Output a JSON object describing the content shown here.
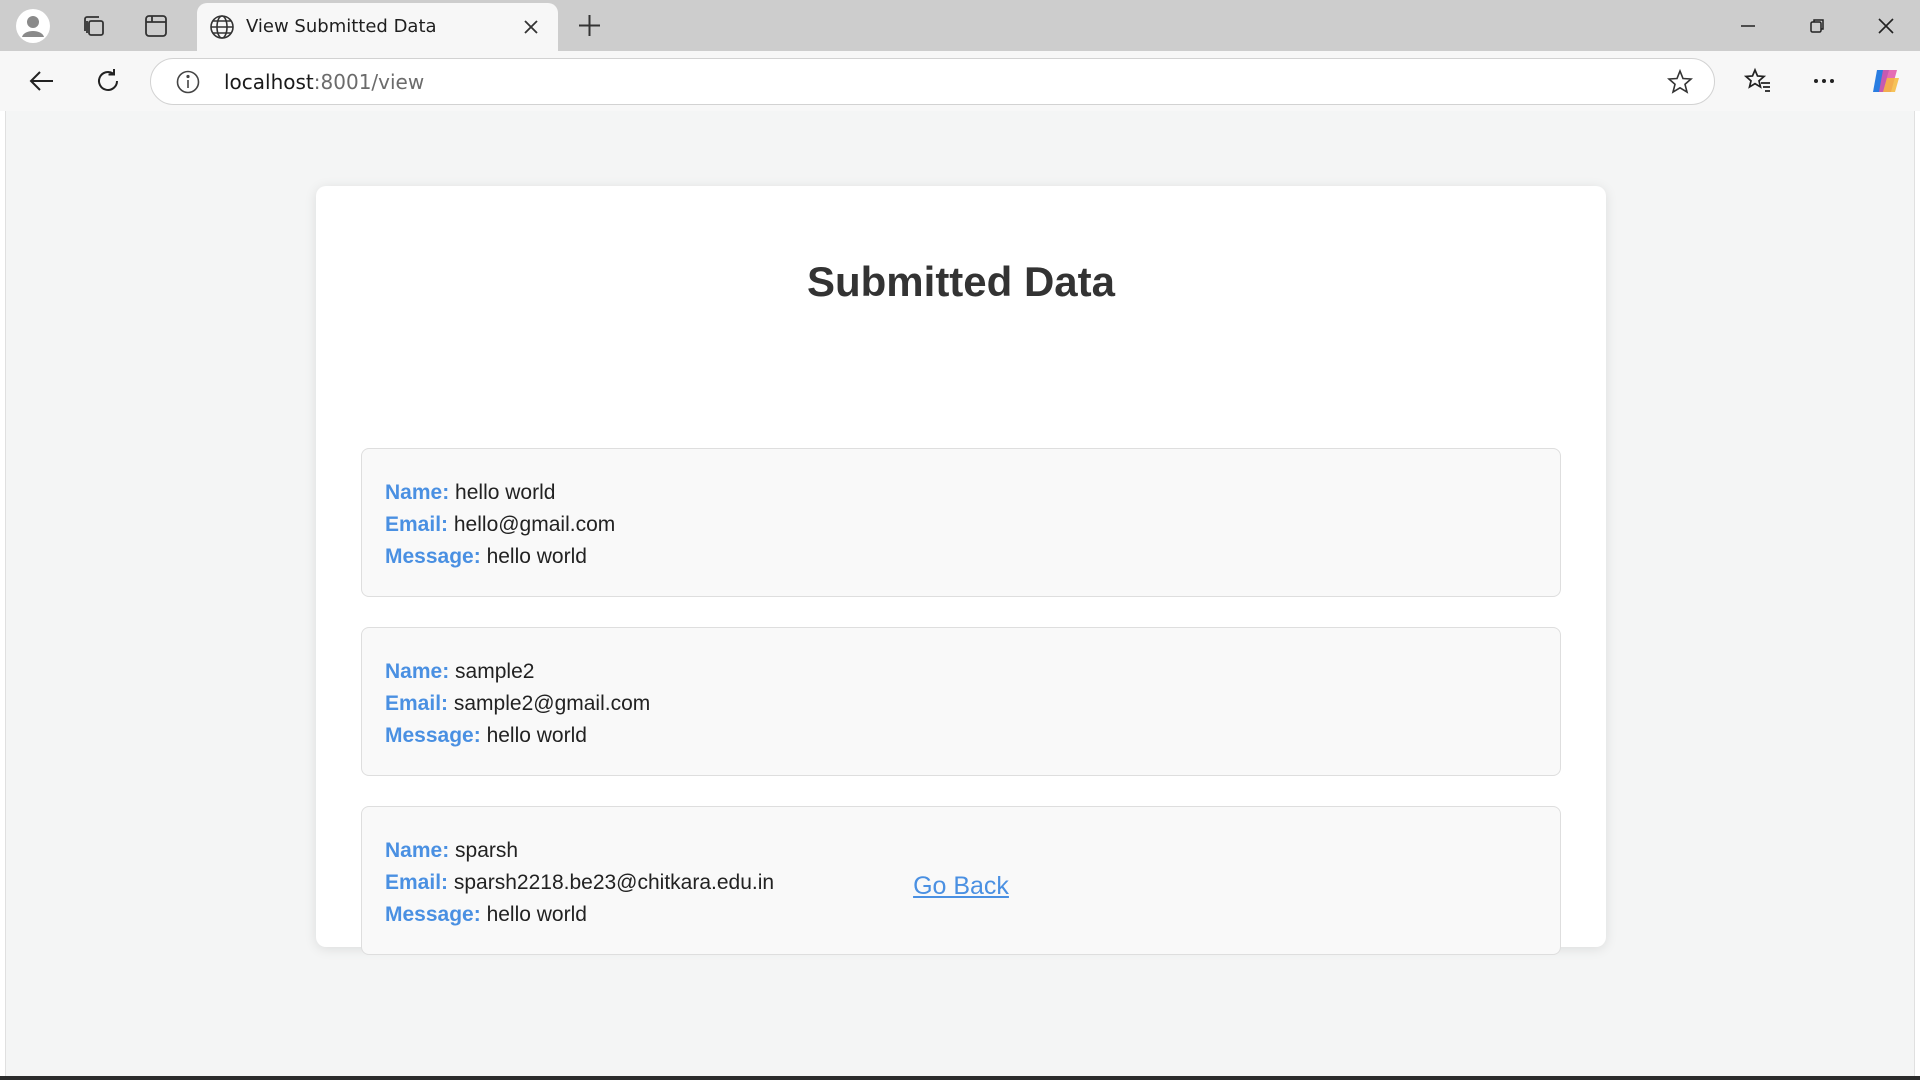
{
  "browser": {
    "tab": {
      "title": "View Submitted Data"
    },
    "address": {
      "host": "localhost",
      "path": ":8001/view"
    },
    "icons": {
      "profile": "profile-icon",
      "workspaces": "collections-icon",
      "tab_actions": "tab-actions-icon",
      "tab_globe": "globe-icon",
      "tab_close": "close-icon",
      "new_tab": "plus-icon",
      "minimize": "minimize-icon",
      "restore": "restore-icon",
      "close_window": "close-icon",
      "back": "back-arrow-icon",
      "reload": "reload-icon",
      "site_info": "info-icon",
      "favorite": "star-icon",
      "favorites": "favorites-icon",
      "more": "more-icon",
      "copilot": "copilot-icon"
    }
  },
  "page": {
    "title": "Submitted Data",
    "labels": {
      "name": "Name:",
      "email": "Email:",
      "message": "Message:"
    },
    "entries": [
      {
        "name": "hello world",
        "email": "hello@gmail.com",
        "message": "hello world"
      },
      {
        "name": "sample2",
        "email": "sample2@gmail.com",
        "message": "hello world"
      },
      {
        "name": "sparsh",
        "email": "sparsh2218.be23@chitkara.edu.in",
        "message": "hello world"
      }
    ],
    "go_back_label": "Go Back"
  },
  "colors": {
    "label_accent": "#4a90e2",
    "title_text": "#333333",
    "page_bg": "#f4f5f5",
    "entry_bg": "#f9f9f9"
  }
}
